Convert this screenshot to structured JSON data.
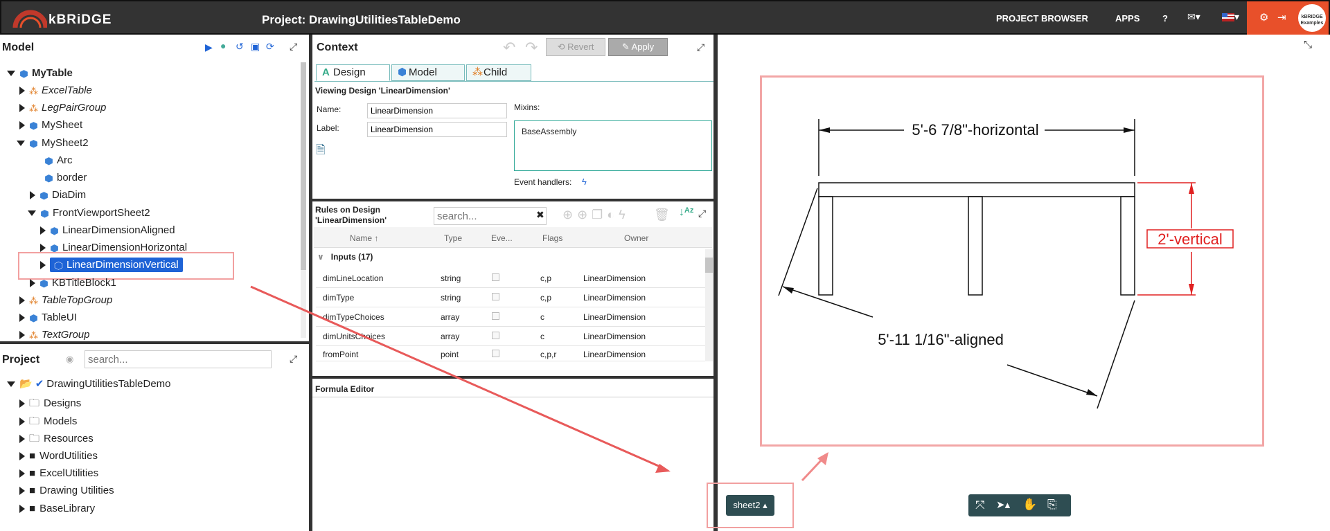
{
  "header": {
    "brand": "kBRiDGE",
    "project_title": "Project: DrawingUtilitiesTableDemo",
    "nav": {
      "project_browser": "PROJECT BROWSER",
      "apps": "APPS",
      "help": "?"
    },
    "avatar_label": "kBRiDGE Examples",
    "accent_color": "#e8502a"
  },
  "model_panel": {
    "title": "Model",
    "tree": [
      {
        "label": "MyTable",
        "bold": true
      },
      {
        "label": "ExcelTable",
        "italic": true
      },
      {
        "label": "LegPairGroup",
        "italic": true
      },
      {
        "label": "MySheet"
      },
      {
        "label": "MySheet2"
      },
      {
        "label": "Arc"
      },
      {
        "label": "border"
      },
      {
        "label": "DiaDim"
      },
      {
        "label": "FrontViewportSheet2"
      },
      {
        "label": "LinearDimensionAligned"
      },
      {
        "label": "LinearDimensionHorizontal"
      },
      {
        "label": "LinearDimensionVertical",
        "selected": true
      },
      {
        "label": "KBTitleBlock1"
      },
      {
        "label": "TableTopGroup",
        "italic": true
      },
      {
        "label": "TableUI"
      },
      {
        "label": "TextGroup",
        "italic": true
      }
    ]
  },
  "project_panel": {
    "title": "Project",
    "search_placeholder": "search...",
    "tree": [
      {
        "label": "DrawingUtilitiesTableDemo"
      },
      {
        "label": "Designs"
      },
      {
        "label": "Models"
      },
      {
        "label": "Resources"
      },
      {
        "label": "WordUtilities"
      },
      {
        "label": "ExcelUtilities"
      },
      {
        "label": "Drawing Utilities"
      },
      {
        "label": "BaseLibrary"
      }
    ]
  },
  "context_panel": {
    "title": "Context",
    "revert_label": "Revert",
    "apply_label": "Apply",
    "tabs": [
      {
        "label": "Design"
      },
      {
        "label": "Model"
      },
      {
        "label": "Child"
      }
    ],
    "viewing": "Viewing Design 'LinearDimension'",
    "name_label": "Name:",
    "name_value": "LinearDimension",
    "label_label": "Label:",
    "label_value": "LinearDimension",
    "mixins_label": "Mixins:",
    "mixins_value": "BaseAssembly",
    "event_handlers_label": "Event handlers:"
  },
  "rules_panel": {
    "title_line1": "Rules on Design",
    "title_line2": "'LinearDimension'",
    "search_placeholder": "search...",
    "columns": {
      "name": "Name",
      "type": "Type",
      "events": "Eve...",
      "flags": "Flags",
      "owner": "Owner"
    },
    "group_label": "Inputs (17)",
    "rows": [
      {
        "name": "dimLineLocation",
        "type": "string",
        "flags": "c,p",
        "owner": "LinearDimension"
      },
      {
        "name": "dimType",
        "type": "string",
        "flags": "c,p",
        "owner": "LinearDimension"
      },
      {
        "name": "dimTypeChoices",
        "type": "array",
        "flags": "c",
        "owner": "LinearDimension"
      },
      {
        "name": "dimUnitsChoices",
        "type": "array",
        "flags": "c",
        "owner": "LinearDimension"
      },
      {
        "name": "fromPoint",
        "type": "point",
        "flags": "c,p,r",
        "owner": "LinearDimension"
      }
    ]
  },
  "formula_editor": {
    "title": "Formula Editor"
  },
  "drawing": {
    "dim_horizontal": "5'-6 7/8\"-horizontal",
    "dim_vertical": "2'-vertical",
    "dim_aligned": "5'-11 1/16\"-aligned",
    "sheet_label": "sheet2"
  }
}
